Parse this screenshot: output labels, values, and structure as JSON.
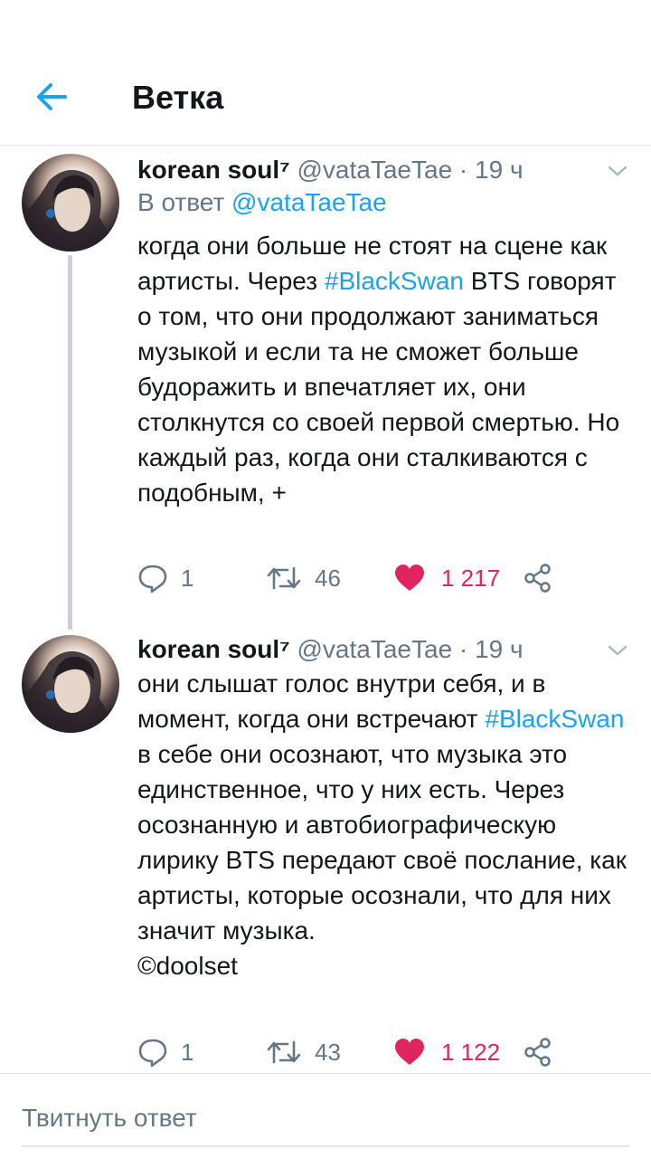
{
  "header": {
    "title": "Ветка",
    "back_icon": "arrow-left-icon",
    "accent_color": "#1da1f2"
  },
  "tweets": [
    {
      "author": {
        "name": "korean soul⁷",
        "handle": "@vataTaeTae"
      },
      "dot": "·",
      "time": "19 ч",
      "reply_to": {
        "prefix": "В ответ",
        "mention": "@vataTaeTae"
      },
      "text": {
        "p1": "когда они больше не стоят на сцене как артисты. Через ",
        "tag": "#BlackSwan",
        "p2": " BTS говорят о том, что они продолжают заниматься музыкой и если та не сможет больше будоражить и впечатляет их, они столкнутся со своей первой смертью. Но каждый раз, когда они сталкиваются с подобным, +"
      },
      "replies": "1",
      "retweets": "46",
      "likes": "1 217"
    },
    {
      "author": {
        "name": "korean soul⁷",
        "handle": "@vataTaeTae"
      },
      "dot": "·",
      "time": "19 ч",
      "text": {
        "p1": "они слышат голос внутри себя, и в момент, когда они встречают ",
        "tag": "#BlackSwan",
        "p2": " в себе они осознают, что музыка это единственное, что у них есть. Через осознанную и автобиографическую лирику BTS передают своё послание, как артисты, которые осознали, что для них значит музыка.",
        "credit": "©doolset"
      },
      "replies": "1",
      "retweets": "43",
      "likes": "1 122"
    }
  ],
  "colors": {
    "link": "#1da1f2",
    "muted": "#657786",
    "like": "#e0245e",
    "text": "#14171a"
  },
  "compose": {
    "placeholder": "Твитнуть ответ"
  }
}
